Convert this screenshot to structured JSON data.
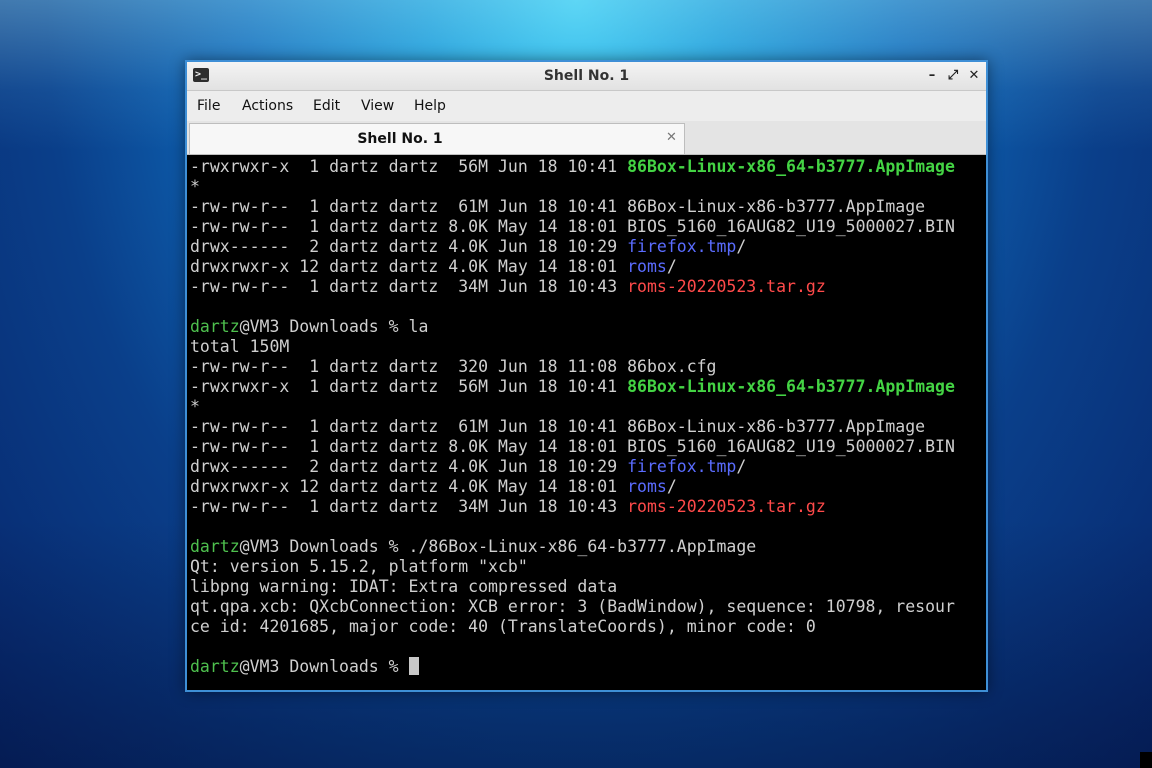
{
  "window": {
    "title": "Shell No. 1"
  },
  "menubar": {
    "items": [
      "File",
      "Actions",
      "Edit",
      "View",
      "Help"
    ]
  },
  "tabs": [
    {
      "label": "Shell No. 1",
      "close": "✕"
    }
  ],
  "titlebar_buttons": {
    "close": "✕",
    "maximize": "⤢",
    "minimize": "–"
  },
  "terminal": {
    "lines": [
      [
        {
          "t": "-rwxrwxr-x  1 dartz dartz  56M Jun 18 10:41 "
        },
        {
          "t": "86Box-Linux-x86_64-b3777.AppImage",
          "c": "g"
        }
      ],
      [
        {
          "t": "*"
        }
      ],
      [
        {
          "t": "-rw-rw-r--  1 dartz dartz  61M Jun 18 10:41 86Box-Linux-x86-b3777.AppImage"
        }
      ],
      [
        {
          "t": "-rw-rw-r--  1 dartz dartz 8.0K May 14 18:01 BIOS_5160_16AUG82_U19_5000027.BIN"
        }
      ],
      [
        {
          "t": "drwx------  2 dartz dartz 4.0K Jun 18 10:29 "
        },
        {
          "t": "firefox.tmp",
          "c": "b"
        },
        {
          "t": "/"
        }
      ],
      [
        {
          "t": "drwxrwxr-x 12 dartz dartz 4.0K May 14 18:01 "
        },
        {
          "t": "roms",
          "c": "b"
        },
        {
          "t": "/"
        }
      ],
      [
        {
          "t": "-rw-rw-r--  1 dartz dartz  34M Jun 18 10:43 "
        },
        {
          "t": "roms-20220523.tar.gz",
          "c": "r"
        }
      ],
      [],
      [
        {
          "t": "dartz",
          "c": "u"
        },
        {
          "t": "@VM3 Downloads % la"
        }
      ],
      [
        {
          "t": "total 150M"
        }
      ],
      [
        {
          "t": "-rw-rw-r--  1 dartz dartz  320 Jun 18 11:08 86box.cfg"
        }
      ],
      [
        {
          "t": "-rwxrwxr-x  1 dartz dartz  56M Jun 18 10:41 "
        },
        {
          "t": "86Box-Linux-x86_64-b3777.AppImage",
          "c": "g"
        }
      ],
      [
        {
          "t": "*"
        }
      ],
      [
        {
          "t": "-rw-rw-r--  1 dartz dartz  61M Jun 18 10:41 86Box-Linux-x86-b3777.AppImage"
        }
      ],
      [
        {
          "t": "-rw-rw-r--  1 dartz dartz 8.0K May 14 18:01 BIOS_5160_16AUG82_U19_5000027.BIN"
        }
      ],
      [
        {
          "t": "drwx------  2 dartz dartz 4.0K Jun 18 10:29 "
        },
        {
          "t": "firefox.tmp",
          "c": "b"
        },
        {
          "t": "/"
        }
      ],
      [
        {
          "t": "drwxrwxr-x 12 dartz dartz 4.0K May 14 18:01 "
        },
        {
          "t": "roms",
          "c": "b"
        },
        {
          "t": "/"
        }
      ],
      [
        {
          "t": "-rw-rw-r--  1 dartz dartz  34M Jun 18 10:43 "
        },
        {
          "t": "roms-20220523.tar.gz",
          "c": "r"
        }
      ],
      [],
      [
        {
          "t": "dartz",
          "c": "u"
        },
        {
          "t": "@VM3 Downloads % ./86Box-Linux-x86_64-b3777.AppImage"
        }
      ],
      [
        {
          "t": "Qt: version 5.15.2, platform \"xcb\""
        }
      ],
      [
        {
          "t": "libpng warning: IDAT: Extra compressed data"
        }
      ],
      [
        {
          "t": "qt.qpa.xcb: QXcbConnection: XCB error: 3 (BadWindow), sequence: 10798, resour"
        }
      ],
      [
        {
          "t": "ce id: 4201685, major code: 40 (TranslateCoords), minor code: 0"
        }
      ],
      [],
      [
        {
          "t": "dartz",
          "c": "u"
        },
        {
          "t": "@VM3 Downloads % "
        }
      ]
    ]
  }
}
